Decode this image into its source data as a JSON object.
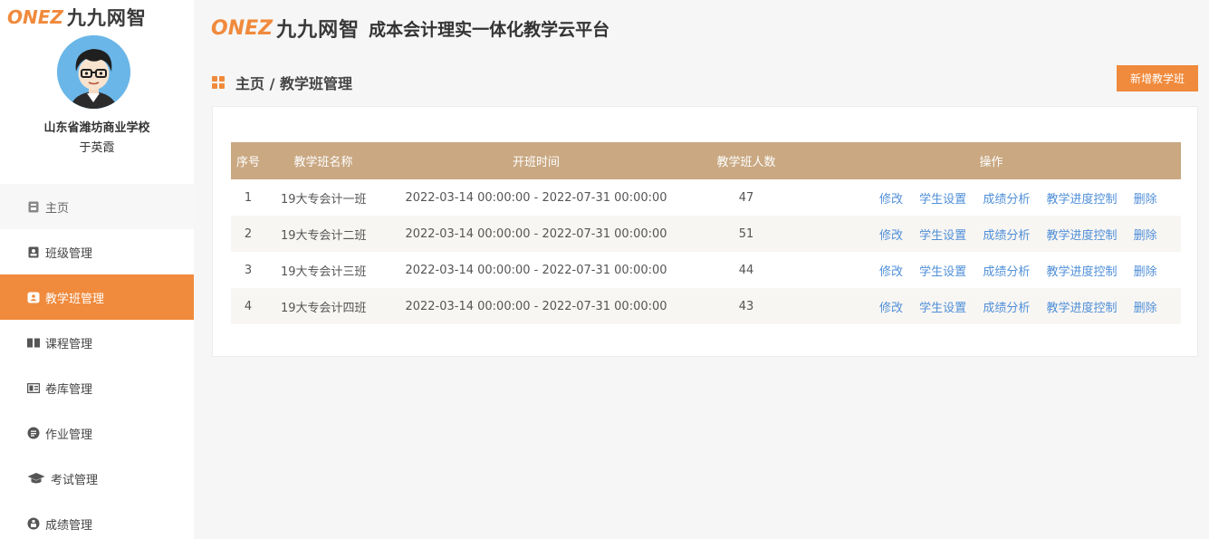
{
  "brand": {
    "logo_latin": "ONEZ",
    "logo_cn": "九九网智",
    "platform_title": "成本会计理实一体化教学云平台"
  },
  "user": {
    "school": "山东省潍坊商业学校",
    "name": "于英霞"
  },
  "menu": [
    {
      "label": "主页",
      "icon": "home-icon"
    },
    {
      "label": "班级管理",
      "icon": "class-icon"
    },
    {
      "label": "教学班管理",
      "icon": "teaching-class-icon",
      "active": true
    },
    {
      "label": "课程管理",
      "icon": "book-icon"
    },
    {
      "label": "卷库管理",
      "icon": "paper-icon"
    },
    {
      "label": "作业管理",
      "icon": "homework-icon"
    },
    {
      "label": "考试管理",
      "icon": "graduation-cap-icon"
    },
    {
      "label": "成绩管理",
      "icon": "score-icon"
    }
  ],
  "breadcrumb": {
    "text": "主页 / 教学班管理"
  },
  "toolbar": {
    "add_label": "新增教学班"
  },
  "table": {
    "headers": [
      "序号",
      "教学班名称",
      "开班时间",
      "教学班人数",
      "操作"
    ],
    "rows": [
      {
        "no": "1",
        "name": "19大专会计一班",
        "time": "2022-03-14 00:00:00 - 2022-07-31 00:00:00",
        "count": "47"
      },
      {
        "no": "2",
        "name": "19大专会计二班",
        "time": "2022-03-14 00:00:00 - 2022-07-31 00:00:00",
        "count": "51"
      },
      {
        "no": "3",
        "name": "19大专会计三班",
        "time": "2022-03-14 00:00:00 - 2022-07-31 00:00:00",
        "count": "44"
      },
      {
        "no": "4",
        "name": "19大专会计四班",
        "time": "2022-03-14 00:00:00 - 2022-07-31 00:00:00",
        "count": "43"
      }
    ],
    "actions": [
      "修改",
      "学生设置",
      "成绩分析",
      "教学进度控制",
      "删除"
    ]
  },
  "colors": {
    "accent": "#f08a3c",
    "table_header": "#c9a882",
    "link": "#4f8fd8"
  }
}
